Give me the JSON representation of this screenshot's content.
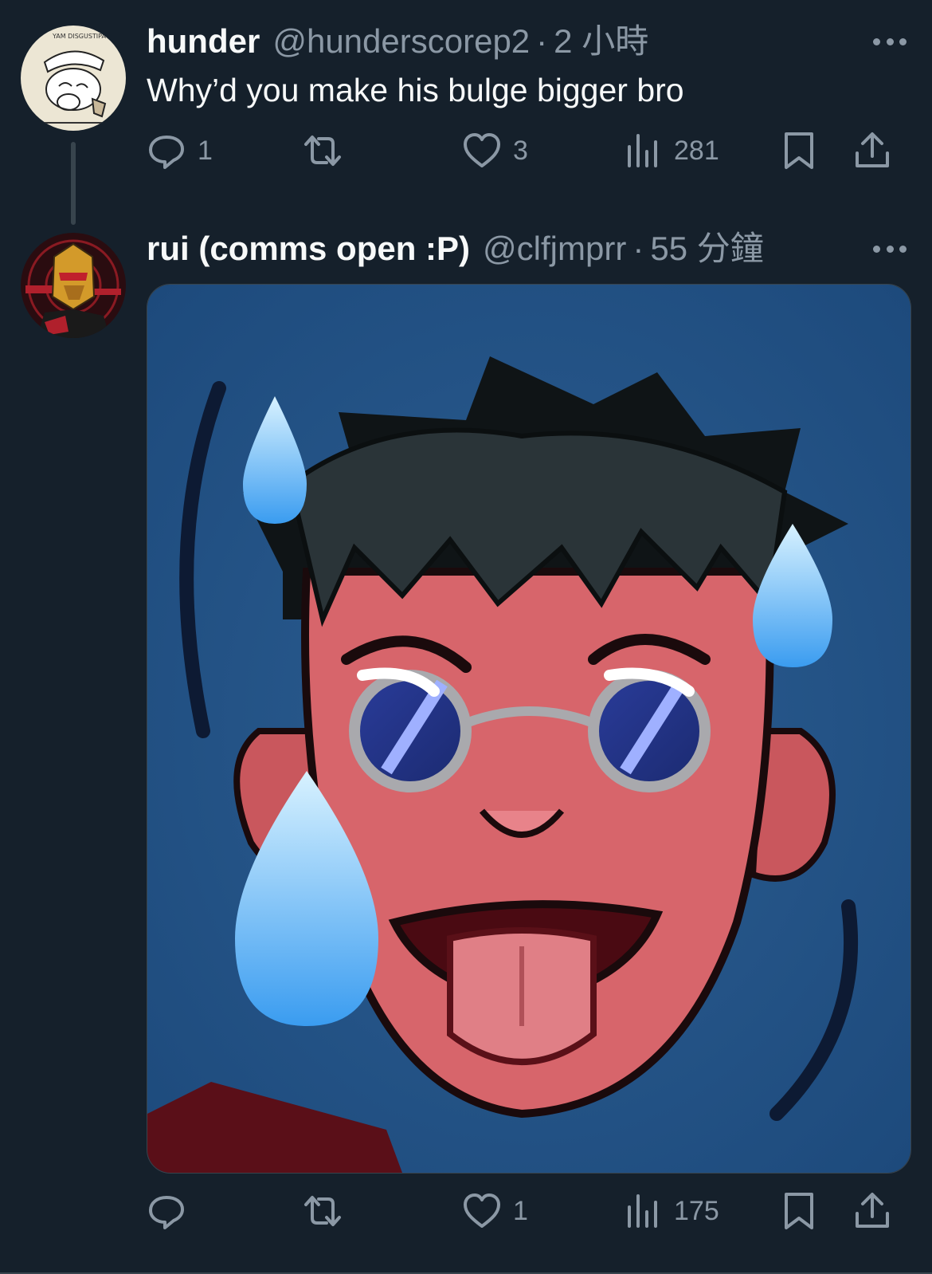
{
  "colors": {
    "background": "#15202b",
    "secondary_text": "#8b98a5",
    "divider": "#38444d"
  },
  "tweets": [
    {
      "display_name": "hunder",
      "handle": "@hunderscorep2",
      "separator": "·",
      "time": "2 小時",
      "text": "Why’d you make his bulge bigger bro",
      "avatar_text": "YAM DISGUSTIPATED",
      "actions": {
        "replies": "1",
        "retweets": "",
        "likes": "3",
        "views": "281"
      }
    },
    {
      "display_name": "rui (comms open :P)",
      "handle": "@clfjmprr",
      "separator": "·",
      "time": "55 分鐘",
      "media": "image",
      "actions": {
        "replies": "",
        "retweets": "",
        "likes": "1",
        "views": "175"
      }
    }
  ]
}
